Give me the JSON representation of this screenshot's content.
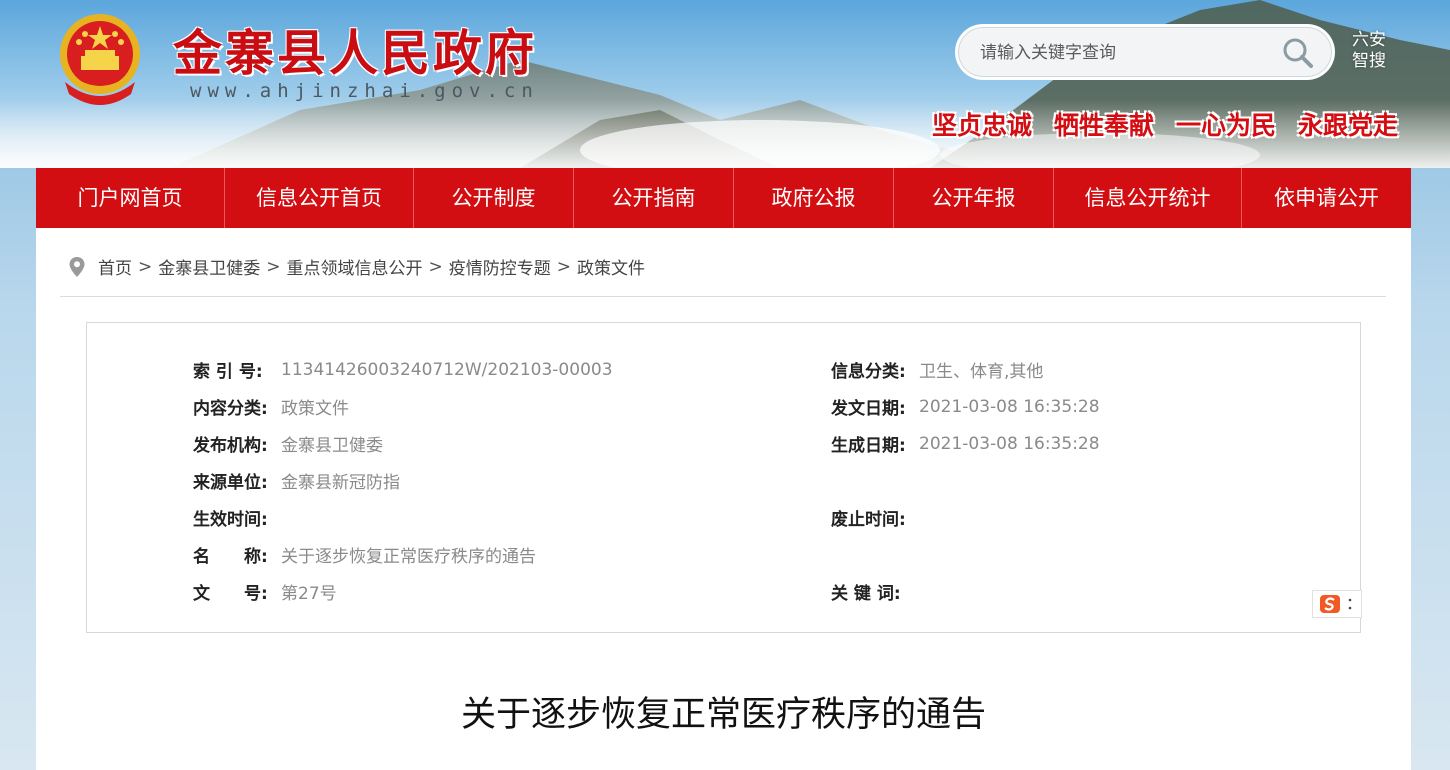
{
  "header": {
    "site_title": "金寨县人民政府",
    "site_url": "www.ahjinzhai.gov.cn",
    "search_placeholder": "请输入关键字查询",
    "brand_link_line1": "六安",
    "brand_link_line2": "智搜",
    "slogans": [
      "坚贞忠诚",
      "牺牲奉献",
      "一心为民",
      "永跟党走"
    ]
  },
  "nav": {
    "items": [
      "门户网首页",
      "信息公开首页",
      "公开制度",
      "公开指南",
      "政府公报",
      "公开年报",
      "信息公开统计",
      "依申请公开"
    ]
  },
  "breadcrumb": {
    "items": [
      "首页",
      "金寨县卫健委",
      "重点领域信息公开",
      "疫情防控专题",
      "政策文件"
    ],
    "separator": ">"
  },
  "meta": {
    "left": [
      {
        "label": "索 引 号:",
        "value": "11341426003240712W/202103-00003"
      },
      {
        "label": "内容分类:",
        "value": "政策文件"
      },
      {
        "label": "发布机构:",
        "value": "金寨县卫健委"
      },
      {
        "label": "来源单位:",
        "value": "金寨县新冠防指"
      },
      {
        "label": "生效时间:",
        "value": ""
      },
      {
        "label": "名　　称:",
        "value": "关于逐步恢复正常医疗秩序的通告"
      },
      {
        "label": "文　　号:",
        "value": "第27号"
      }
    ],
    "right": [
      {
        "label": "信息分类:",
        "value": "卫生、体育,其他"
      },
      {
        "label": "发文日期:",
        "value": "2021-03-08 16:35:28"
      },
      {
        "label": "生成日期:",
        "value": "2021-03-08 16:35:28"
      },
      {
        "label": "",
        "value": ""
      },
      {
        "label": "废止时间:",
        "value": ""
      },
      {
        "label": "",
        "value": ""
      },
      {
        "label": "关 键 词:",
        "value": ""
      }
    ]
  },
  "document": {
    "title": "关于逐步恢复正常医疗秩序的通告"
  },
  "colors": {
    "primary_red": "#d30e12",
    "label_text": "#222222",
    "value_text": "#8a8a8a"
  },
  "icons": {
    "search": "magnifier-icon",
    "breadcrumb": "location-pin-icon",
    "emblem": "national-emblem-icon",
    "ime": "sogou-ime-icon"
  }
}
